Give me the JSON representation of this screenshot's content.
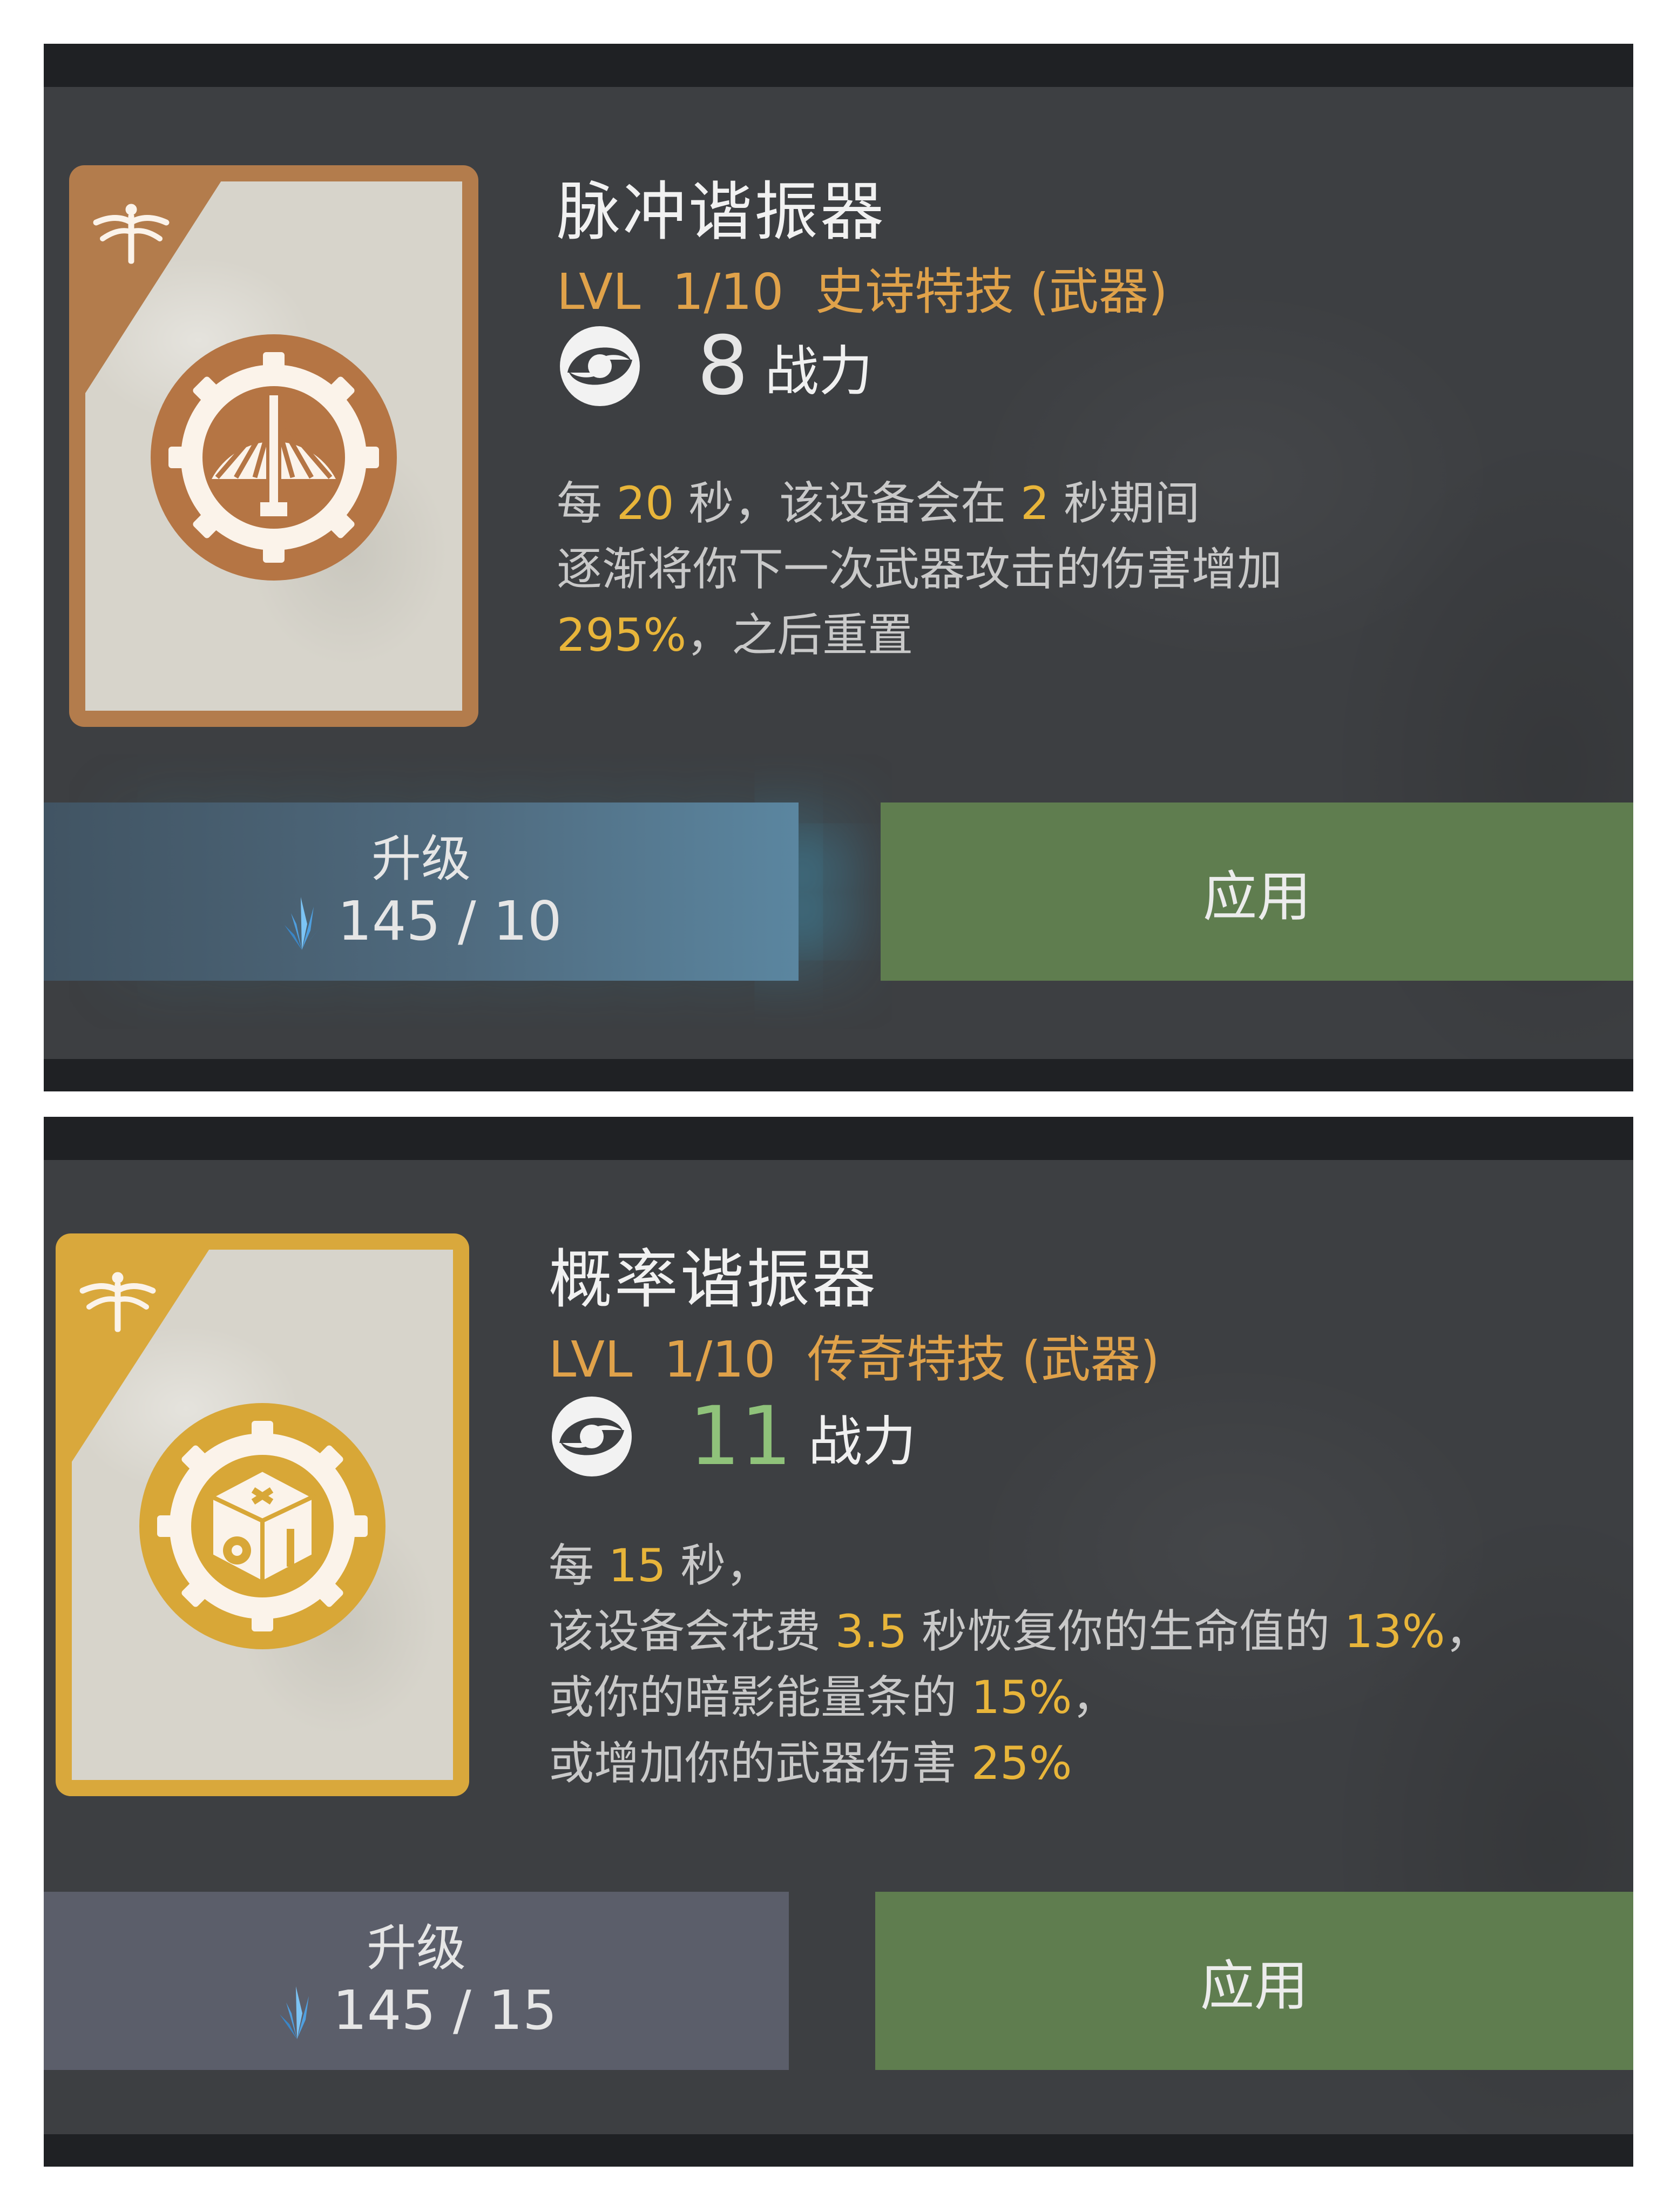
{
  "cards": [
    {
      "name": "脉冲谐振器",
      "level": "LVL  1/10  史诗特技 (武器)",
      "power_value": "8",
      "power_label": "战力",
      "description": [
        [
          {
            "t": "每 "
          },
          {
            "t": "20",
            "h": true
          },
          {
            "t": " 秒，该设备会在 "
          },
          {
            "t": "2",
            "h": true
          },
          {
            "t": " 秒期间"
          }
        ],
        [
          {
            "t": "逐渐将你下一次武器攻击的伤害增加"
          }
        ],
        [
          {
            "t": "295%",
            "h": true
          },
          {
            "t": "，之后重置"
          }
        ]
      ],
      "upgrade_label": "升级",
      "upgrade_cost": "145 / 10",
      "apply_label": "应用",
      "rarity_color": "#b07a4a",
      "power_color": "#e6e6e6"
    },
    {
      "name": "概率谐振器",
      "level": "LVL  1/10  传奇特技 (武器)",
      "power_value": "11",
      "power_label": "战力",
      "description": [
        [
          {
            "t": "每 "
          },
          {
            "t": "15",
            "h": true
          },
          {
            "t": " 秒，"
          }
        ],
        [
          {
            "t": "该设备会花费 "
          },
          {
            "t": "3.5",
            "h": true
          },
          {
            "t": " 秒恢复你的生命值的 "
          },
          {
            "t": "13%",
            "h": true
          },
          {
            "t": "，"
          }
        ],
        [
          {
            "t": "或你的暗影能量条的 "
          },
          {
            "t": "15%",
            "h": true
          },
          {
            "t": "，"
          }
        ],
        [
          {
            "t": "或增加你的武器伤害 "
          },
          {
            "t": "25%",
            "h": true
          }
        ]
      ],
      "upgrade_label": "升级",
      "upgrade_cost": "145 / 15",
      "apply_label": "应用",
      "rarity_color": "#d4a43a",
      "power_color": "#8fc27a"
    }
  ]
}
